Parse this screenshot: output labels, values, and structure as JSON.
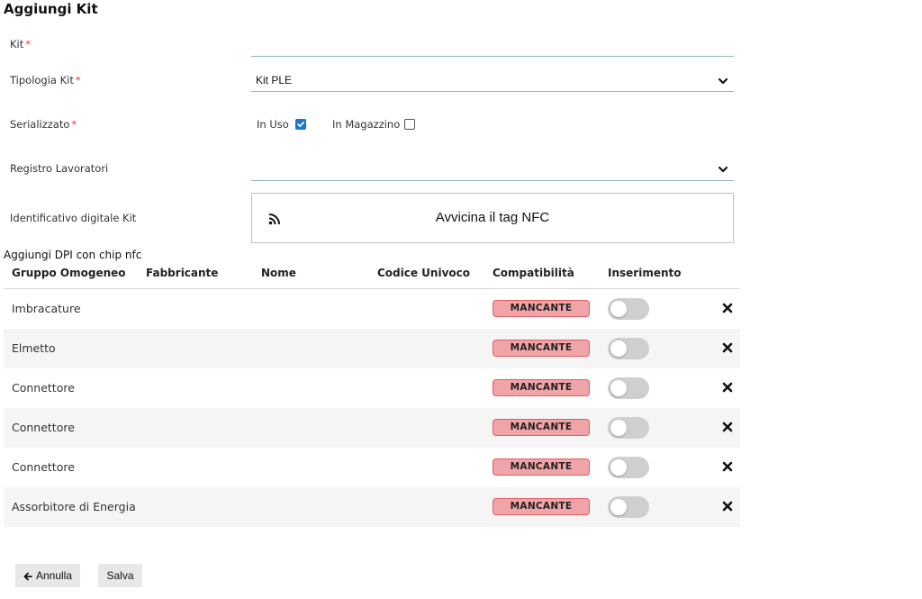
{
  "page": {
    "title": "Aggiungi Kit"
  },
  "form": {
    "kit": {
      "label": "Kit",
      "required_mark": "*",
      "value": ""
    },
    "tipologia": {
      "label": "Tipologia Kit",
      "required_mark": "*",
      "value": "Kit PLE"
    },
    "serializzato": {
      "label": "Serializzato",
      "required_mark": "*",
      "in_uso": {
        "label": "In Uso",
        "checked": true
      },
      "in_magazzino": {
        "label": "In Magazzino",
        "checked": false
      }
    },
    "registro": {
      "label": "Registro Lavoratori",
      "value": ""
    },
    "identificativo": {
      "label": "Identificativo digitale Kit",
      "nfc_prompt": "Avvicina il tag NFC",
      "icon": "rss-icon"
    }
  },
  "dpi": {
    "subtitle": "Aggiungi DPI con chip nfc",
    "columns": [
      "Gruppo Omogeneo",
      "Fabbricante",
      "Nome",
      "Codice Univoco",
      "Compatibilità",
      "Inserimento"
    ],
    "rows": [
      {
        "gruppo": "Imbracature",
        "fabbricante": "",
        "nome": "",
        "codice": "",
        "compatibilita": "MANCANTE",
        "inserimento": false
      },
      {
        "gruppo": "Elmetto",
        "fabbricante": "",
        "nome": "",
        "codice": "",
        "compatibilita": "MANCANTE",
        "inserimento": false
      },
      {
        "gruppo": "Connettore",
        "fabbricante": "",
        "nome": "",
        "codice": "",
        "compatibilita": "MANCANTE",
        "inserimento": false
      },
      {
        "gruppo": "Connettore",
        "fabbricante": "",
        "nome": "",
        "codice": "",
        "compatibilita": "MANCANTE",
        "inserimento": false
      },
      {
        "gruppo": "Connettore",
        "fabbricante": "",
        "nome": "",
        "codice": "",
        "compatibilita": "MANCANTE",
        "inserimento": false
      },
      {
        "gruppo": "Assorbitore di Energia",
        "fabbricante": "",
        "nome": "",
        "codice": "",
        "compatibilita": "MANCANTE",
        "inserimento": false
      }
    ]
  },
  "actions": {
    "annulla": "Annulla",
    "salva": "Salva"
  },
  "colors": {
    "accent": "#1976d2",
    "badge_bg": "#f0a4a8",
    "badge_border": "#e25d63",
    "underline": "#8fb1c3"
  }
}
